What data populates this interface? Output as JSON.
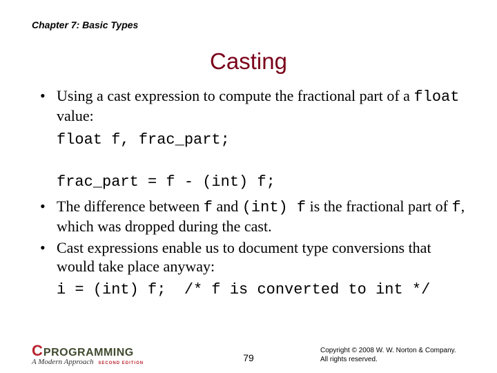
{
  "chapter": "Chapter 7: Basic Types",
  "title": "Casting",
  "bullet1_a": "Using a cast expression to compute the fractional part of a ",
  "bullet1_code": "float",
  "bullet1_b": " value:",
  "code1": "float f, frac_part;\n\nfrac_part = f - (int) f;",
  "bullet2_a": "The difference between ",
  "bullet2_code1": "f",
  "bullet2_b": " and ",
  "bullet2_code2": "(int) f",
  "bullet2_c": " is the fractional part of ",
  "bullet2_code3": "f",
  "bullet2_d": ", which was dropped during the cast.",
  "bullet3": "Cast expressions enable us to document type conversions that would take place anyway:",
  "code2": "i = (int) f;  /* f is converted to int */",
  "logo_c": "C",
  "logo_prog": "PROGRAMMING",
  "logo_sub": "A Modern Approach",
  "logo_ed": "SECOND EDITION",
  "page": "79",
  "copy1": "Copyright © 2008 W. W. Norton & Company.",
  "copy2": "All rights reserved."
}
